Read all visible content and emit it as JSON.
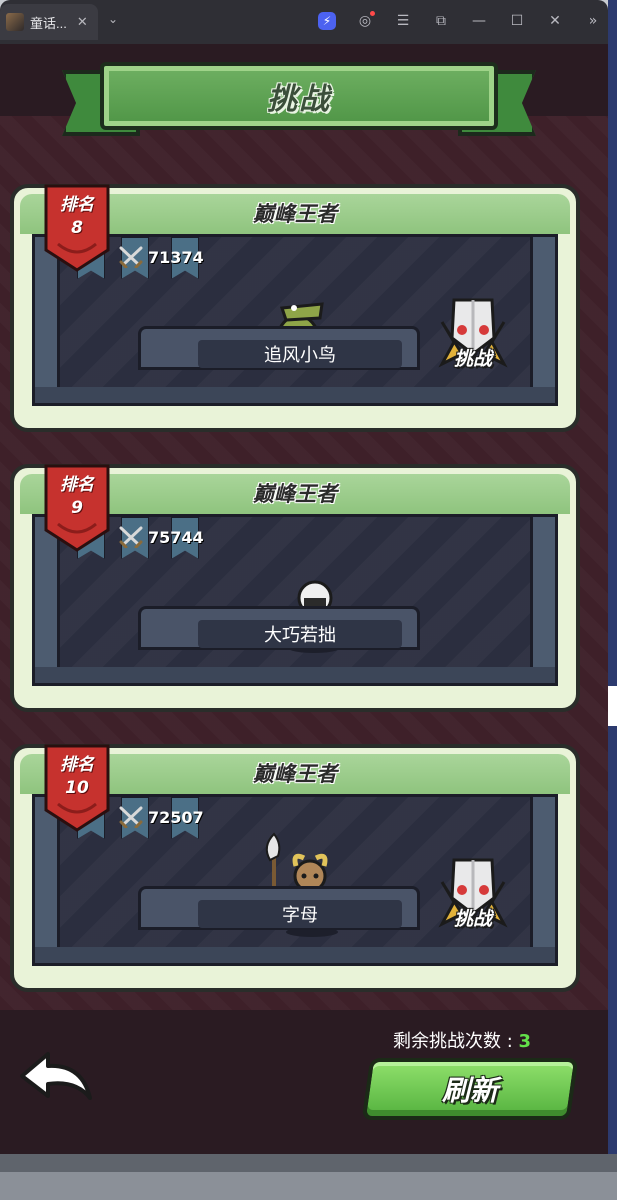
{
  "window": {
    "tab_title": "童话...",
    "tab_close": "✕",
    "tab_menu": "⌄",
    "controls": [
      "⚡",
      "◎",
      "☰",
      "⧉",
      "—",
      "☐",
      "✕",
      "»"
    ]
  },
  "header": {
    "title": "挑战"
  },
  "cards": [
    {
      "rank_label": "排名",
      "rank": "8",
      "league": "巅峰王者",
      "power": "71374",
      "name": "追风小鸟",
      "challenge_label": "挑战",
      "hero": "crocodile-warrior"
    },
    {
      "rank_label": "排名",
      "rank": "9",
      "league": "巅峰王者",
      "power": "75744",
      "name": "大巧若拙",
      "challenge_label": "",
      "hero": "hooded-swordsman"
    },
    {
      "rank_label": "排名",
      "rank": "10",
      "league": "巅峰王者",
      "power": "72507",
      "name": "字母",
      "challenge_label": "挑战",
      "hero": "goat-halberdier"
    }
  ],
  "footer": {
    "remaining_label": "剩余挑战次数 :",
    "remaining_count": "3",
    "refresh_label": "刷新",
    "back_icon": "back-arrow-icon"
  },
  "colors": {
    "accent_green": "#63e14a",
    "banner_green": "#4f9546",
    "rank_red": "#c6322e",
    "background": "#3e2029"
  }
}
